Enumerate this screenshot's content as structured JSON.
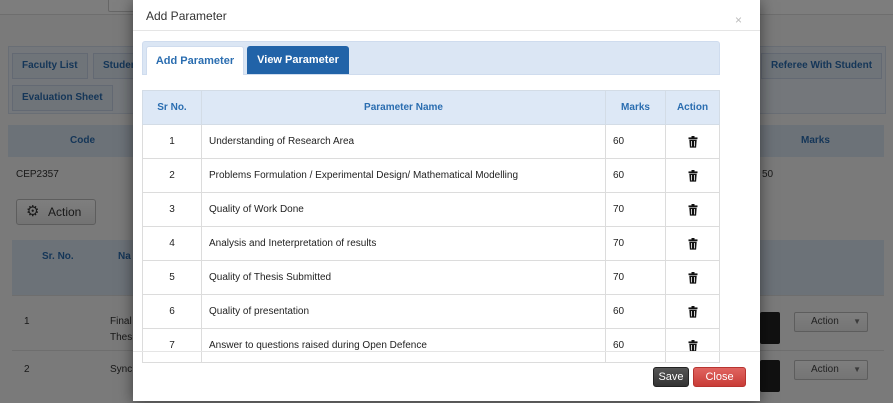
{
  "background": {
    "tabs": [
      "Faculty List",
      "Studen",
      "Referee With Student",
      "Evaluation Sheet"
    ],
    "table_headers": [
      "Code",
      "Marks"
    ],
    "row_code": "CEP2357",
    "row_marks_partial": "50",
    "action_label": "Action",
    "subtable_headers": [
      "Sr. No.",
      "Na"
    ],
    "rows": [
      {
        "sr": "1",
        "name_line1": "Final",
        "name_line2": "Thes",
        "action": "Action"
      },
      {
        "sr": "2",
        "name_line1": "Sync",
        "action": "Action"
      }
    ]
  },
  "modal": {
    "title": "Add Parameter",
    "close_glyph": "×",
    "tabs": {
      "add": "Add Parameter",
      "view": "View Parameter"
    },
    "columns": {
      "sr": "Sr No.",
      "name": "Parameter Name",
      "marks": "Marks",
      "action": "Action"
    },
    "rows": [
      {
        "sr": "1",
        "name": "Understanding of Research Area",
        "marks": "60"
      },
      {
        "sr": "2",
        "name": "Problems Formulation / Experimental Design/ Mathematical Modelling",
        "marks": "60"
      },
      {
        "sr": "3",
        "name": "Quality of Work Done",
        "marks": "70"
      },
      {
        "sr": "4",
        "name": "Analysis and Ineterpretation of results",
        "marks": "70"
      },
      {
        "sr": "5",
        "name": "Quality of Thesis Submitted",
        "marks": "70"
      },
      {
        "sr": "6",
        "name": "Quality of presentation",
        "marks": "60"
      },
      {
        "sr": "7",
        "name": "Answer to questions raised during Open Defence",
        "marks": "60"
      }
    ],
    "row_action_icon": "trash-icon",
    "footer": {
      "save": "Save",
      "close": "Close"
    }
  },
  "colors": {
    "accent": "#2163a8",
    "danger": "#c93c37",
    "header_bg": "#dde8f6"
  }
}
